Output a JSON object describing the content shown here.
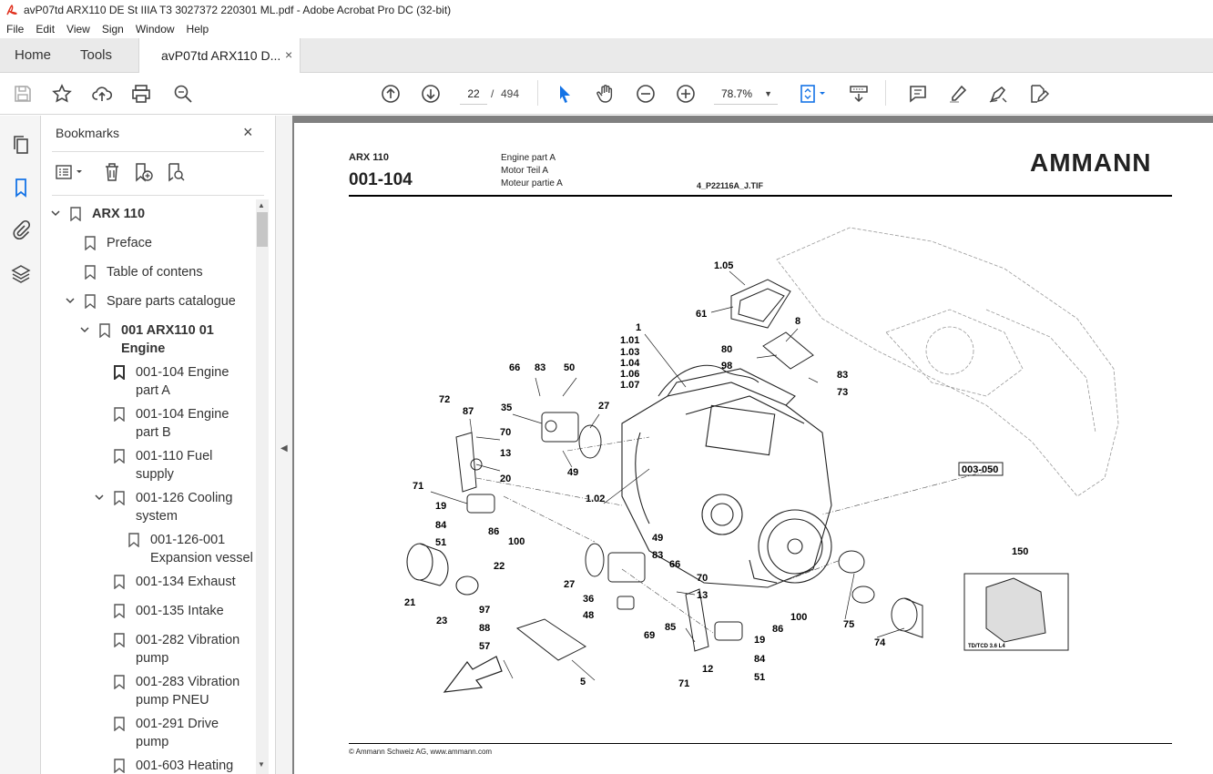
{
  "window": {
    "title": "avP07td ARX110 DE St IIIA T3 3027372 220301 ML.pdf - Adobe Acrobat Pro DC (32-bit)"
  },
  "menu": [
    "File",
    "Edit",
    "View",
    "Sign",
    "Window",
    "Help"
  ],
  "tabs": {
    "home": "Home",
    "tools": "Tools",
    "doc": "avP07td ARX110 D...",
    "close": "×"
  },
  "nav": {
    "page_current": "22",
    "page_sep": "/",
    "page_total": "494",
    "zoom": "78.7%"
  },
  "bookmarks": {
    "title": "Bookmarks",
    "close": "×",
    "items": [
      {
        "label": "ARX 110"
      },
      {
        "label": "Preface"
      },
      {
        "label": "Table of contens"
      },
      {
        "label": "Spare parts catalogue"
      },
      {
        "label": "001 ARX110 01",
        "label2": "Engine"
      },
      {
        "label": "001-104 Engine",
        "label2": "part A"
      },
      {
        "label": "001-104 Engine",
        "label2": "part B"
      },
      {
        "label": "001-110 Fuel",
        "label2": "supply"
      },
      {
        "label": "001-126 Cooling",
        "label2": "system"
      },
      {
        "label": "001-126-001",
        "label2": "Expansion vessel"
      },
      {
        "label": "001-134 Exhaust"
      },
      {
        "label": "001-135 Intake"
      },
      {
        "label": "001-282 Vibration",
        "label2": "pump"
      },
      {
        "label": "001-283 Vibration",
        "label2": "pump PNEU"
      },
      {
        "label": "001-291 Drive",
        "label2": "pump"
      },
      {
        "label": "001-603 Heating"
      }
    ]
  },
  "page": {
    "model": "ARX 110",
    "code": "001-104",
    "desc": [
      "Engine part A",
      "Motor Teil A",
      "Moteur partie A"
    ],
    "file": "4_P22116A_J.TIF",
    "logo": "AMMANN",
    "footer": "© Ammann Schweiz AG, www.ammann.com",
    "ref": "003-050",
    "label_title": "TD/TCD 3.6 L4",
    "callouts": [
      "1.05",
      "61",
      "8",
      "1",
      "1.01",
      "1.03",
      "1.04",
      "1.06",
      "1.07",
      "80",
      "98",
      "83",
      "73",
      "66",
      "83",
      "50",
      "35",
      "27",
      "72",
      "87",
      "70",
      "13",
      "20",
      "49",
      "71",
      "19",
      "84",
      "86",
      "100",
      "51",
      "1.02",
      "49",
      "83",
      "66",
      "27",
      "70",
      "13",
      "36",
      "48",
      "69",
      "85",
      "19",
      "86",
      "100",
      "75",
      "74",
      "84",
      "51",
      "12",
      "71",
      "21",
      "22",
      "23",
      "97",
      "88",
      "57",
      "5",
      "150"
    ]
  },
  "colors": {
    "accent": "#1473e6",
    "docbg": "#808080"
  }
}
